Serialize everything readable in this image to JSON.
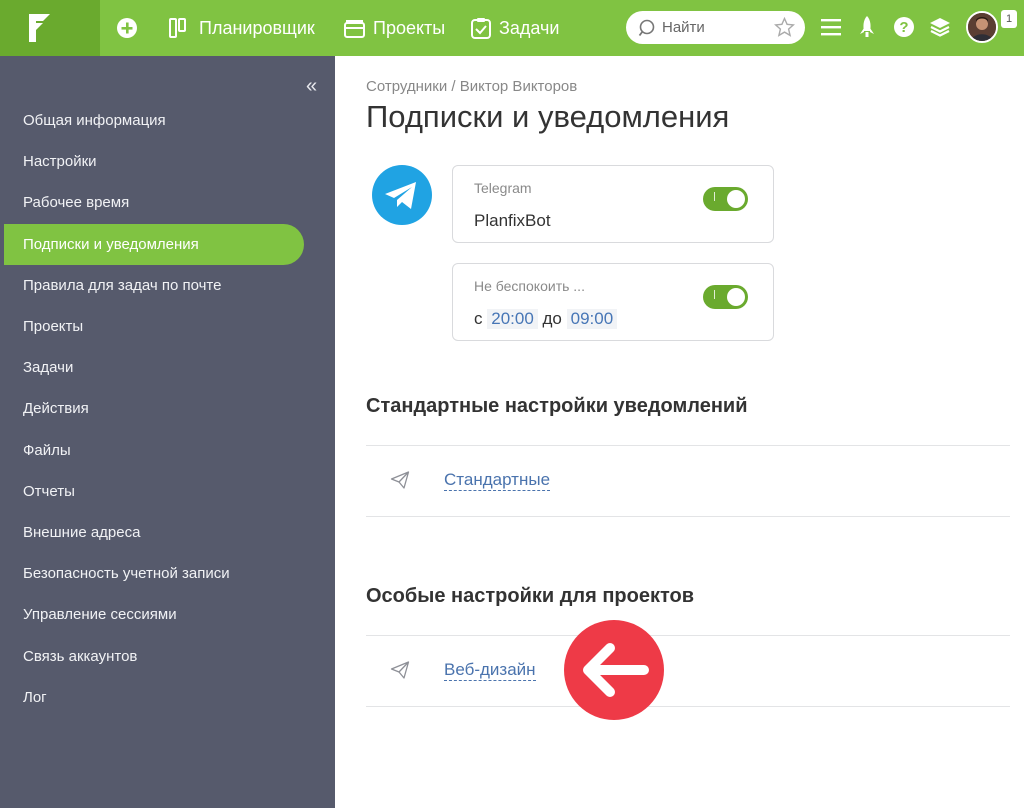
{
  "topbar": {
    "nav": [
      {
        "label": "Планировщик"
      },
      {
        "label": "Проекты"
      },
      {
        "label": "Задачи"
      }
    ],
    "search_placeholder": "Найти",
    "notification_count": "1"
  },
  "sidebar": {
    "items": [
      {
        "label": "Общая информация"
      },
      {
        "label": "Настройки"
      },
      {
        "label": "Рабочее время"
      },
      {
        "label": "Подписки и уведомления"
      },
      {
        "label": "Правила для задач по почте"
      },
      {
        "label": "Проекты"
      },
      {
        "label": "Задачи"
      },
      {
        "label": "Действия"
      },
      {
        "label": "Файлы"
      },
      {
        "label": "Отчеты"
      },
      {
        "label": "Внешние адреса"
      },
      {
        "label": "Безопасность учетной записи"
      },
      {
        "label": "Управление сессиями"
      },
      {
        "label": "Связь аккаунтов"
      },
      {
        "label": "Лог"
      }
    ],
    "active_index": 3
  },
  "main": {
    "breadcrumb": {
      "parent": "Сотрудники",
      "separator": " / ",
      "current": "Виктор Викторов"
    },
    "title": "Подписки и уведомления",
    "telegram": {
      "label": "Telegram",
      "value": "PlanfixBot",
      "enabled": true
    },
    "dnd": {
      "label": "Не беспокоить ...",
      "from_prefix": "с",
      "from": "20:00",
      "to_prefix": "до",
      "to": "09:00",
      "enabled": true
    },
    "standard_section": {
      "title": "Стандартные настройки уведомлений",
      "link": "Стандартные"
    },
    "projects_section": {
      "title": "Особые настройки для проектов",
      "link": "Веб-дизайн"
    }
  },
  "colors": {
    "brand_green": "#80c342",
    "sidebar_bg": "#565a6c",
    "telegram_blue": "#20a3e3",
    "accent_red": "#ee3a47"
  }
}
